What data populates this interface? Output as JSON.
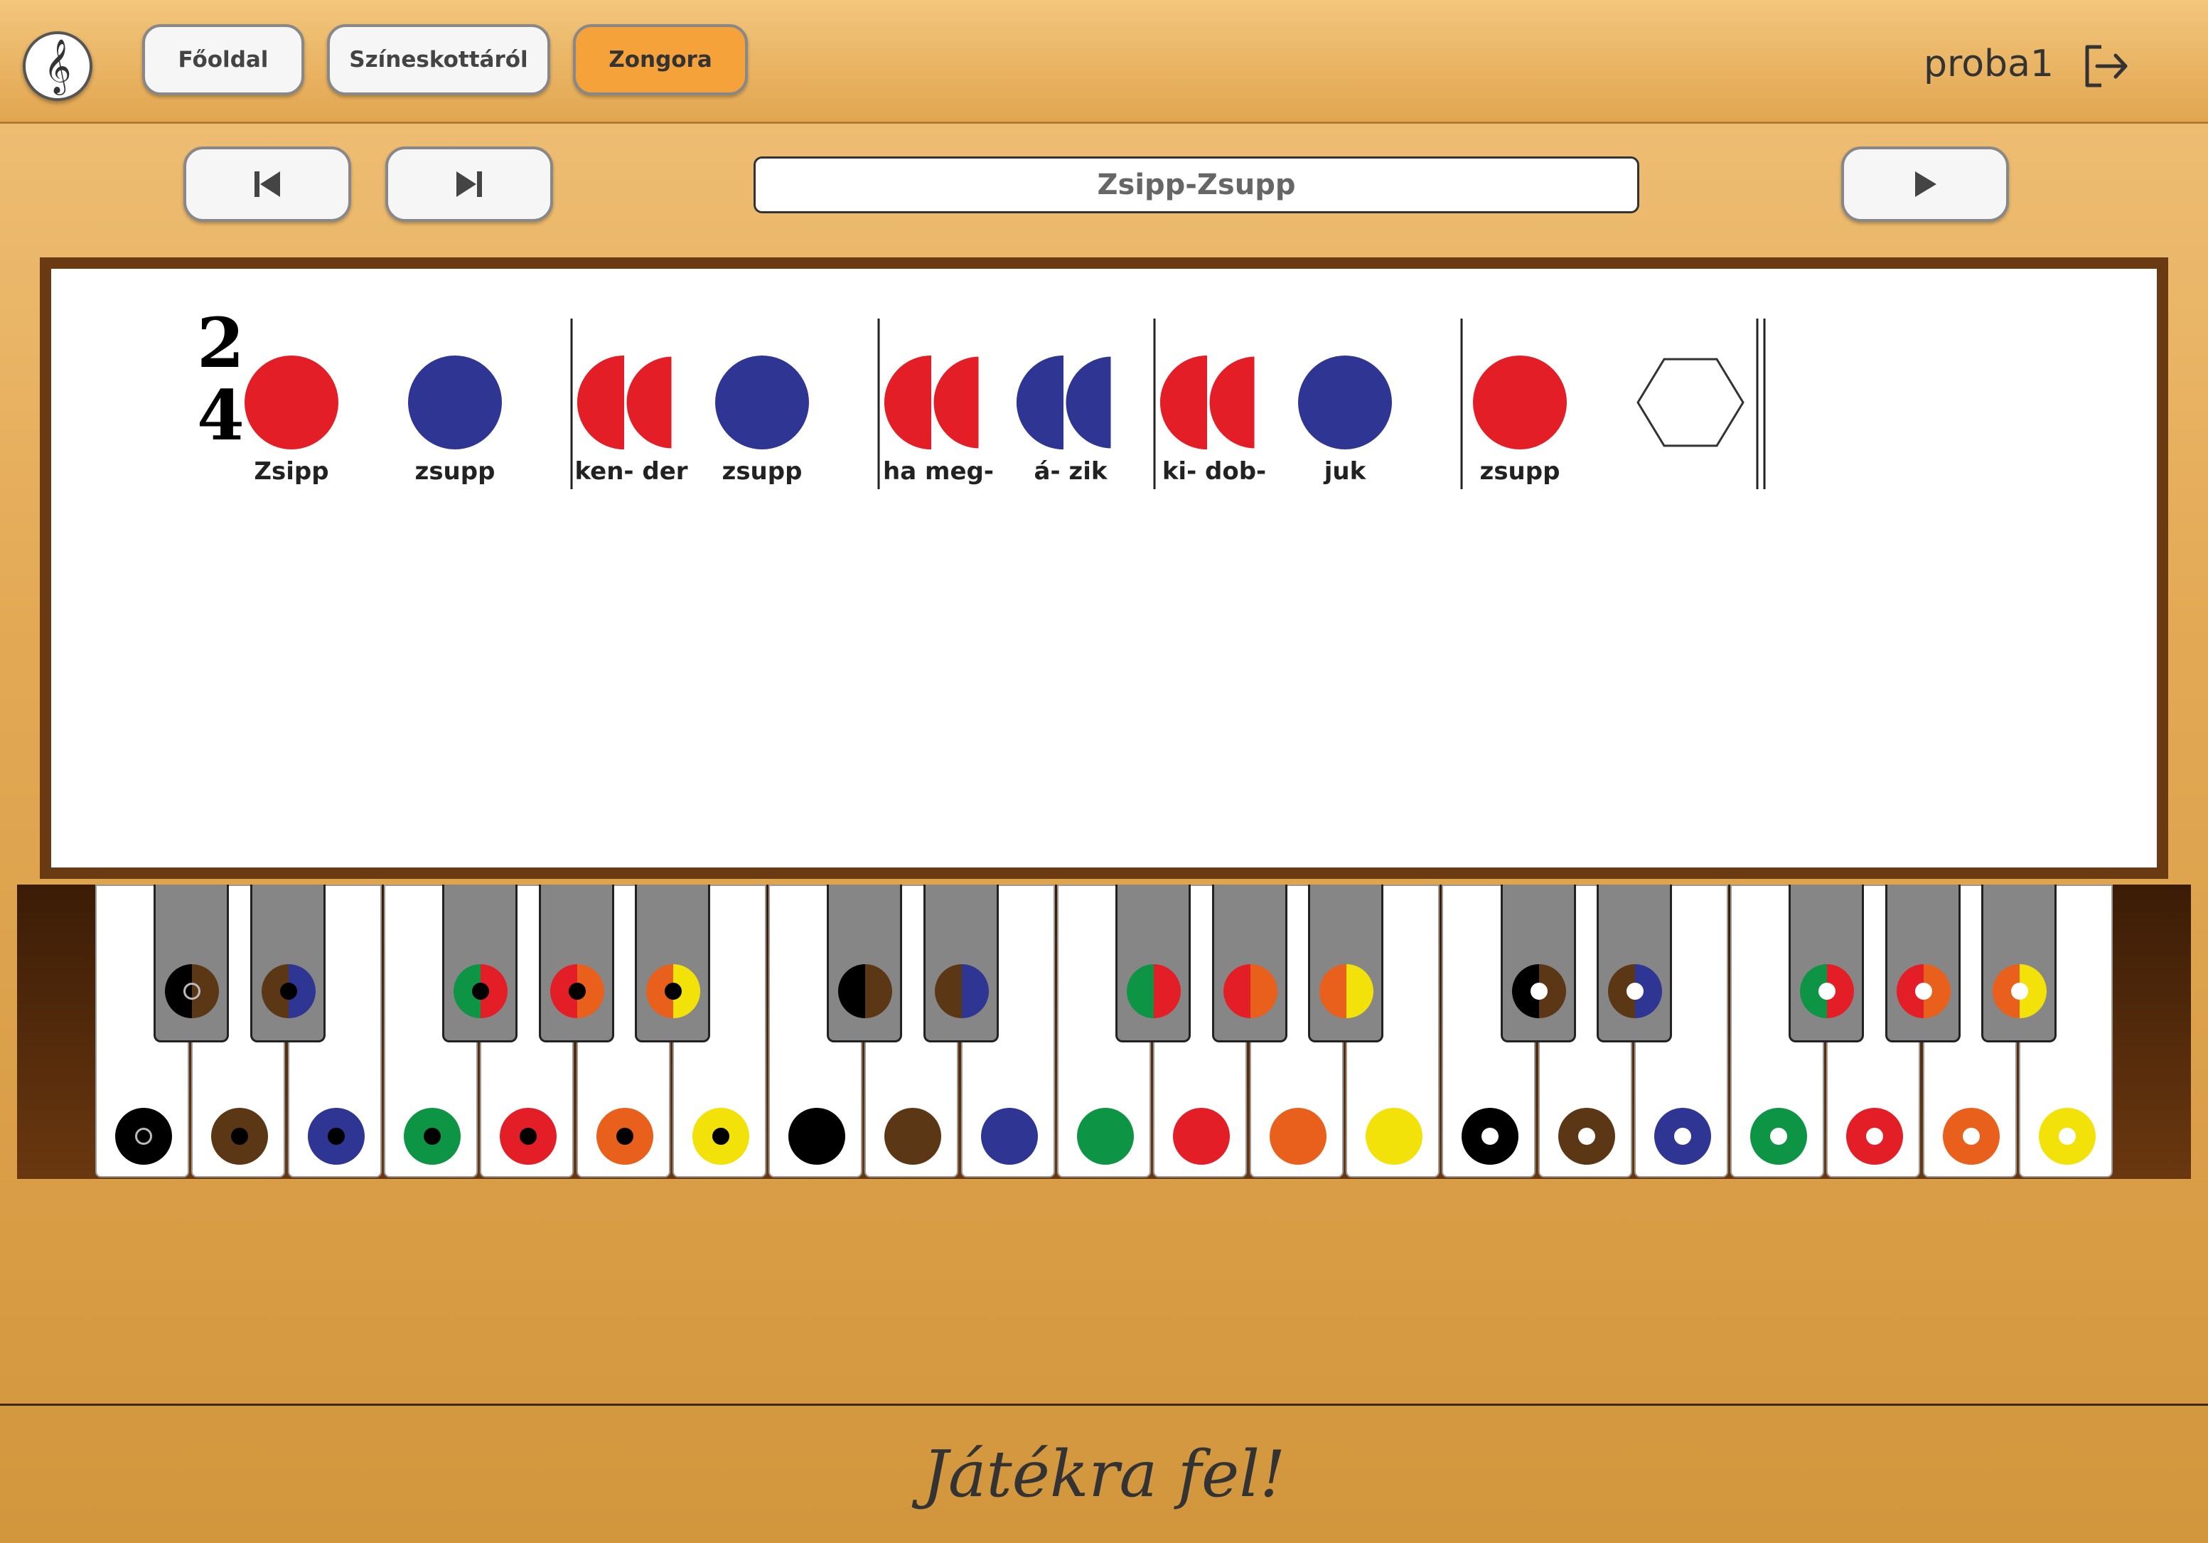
{
  "header": {
    "logo_glyph": "𝄞",
    "nav": [
      {
        "label": "Főoldal",
        "active": false
      },
      {
        "label": "Színeskottáról",
        "active": false
      },
      {
        "label": "Zongora",
        "active": true
      }
    ],
    "username": "proba1",
    "logout_icon": "logout-icon"
  },
  "controls": {
    "prev_icon": "skip-back-icon",
    "next_icon": "skip-forward-icon",
    "play_icon": "play-icon",
    "song_title": "Zsipp-Zsupp"
  },
  "score": {
    "time_signature": {
      "top": "2",
      "bottom": "4"
    },
    "notes": [
      {
        "type": "full",
        "colors": [
          "#e41e26"
        ],
        "lyric": "Zsipp"
      },
      {
        "type": "full",
        "colors": [
          "#2e3592"
        ],
        "lyric": "zsupp"
      },
      {
        "type": "bar"
      },
      {
        "type": "pair",
        "colors": [
          "#e41e26",
          "#e41e26"
        ],
        "lyric": "ken- der"
      },
      {
        "type": "full",
        "colors": [
          "#2e3592"
        ],
        "lyric": "zsupp"
      },
      {
        "type": "bar"
      },
      {
        "type": "pair",
        "colors": [
          "#e41e26",
          "#e41e26"
        ],
        "lyric": "ha  meg-"
      },
      {
        "type": "pair",
        "colors": [
          "#2e3592",
          "#2e3592"
        ],
        "lyric": "á-  zik"
      },
      {
        "type": "bar"
      },
      {
        "type": "pair",
        "colors": [
          "#e41e26",
          "#e41e26"
        ],
        "lyric": "ki-   dob-"
      },
      {
        "type": "full",
        "colors": [
          "#2e3592"
        ],
        "lyric": "juk"
      },
      {
        "type": "bar"
      },
      {
        "type": "full",
        "colors": [
          "#e41e26"
        ],
        "lyric": "zsupp"
      },
      {
        "type": "rest"
      },
      {
        "type": "end"
      }
    ]
  },
  "piano": {
    "white_keys": [
      {
        "color": "#000000",
        "inner": "ring"
      },
      {
        "color": "#5c3716",
        "inner": "#000000"
      },
      {
        "color": "#2e3592",
        "inner": "#000000"
      },
      {
        "color": "#0d9444",
        "inner": "#000000"
      },
      {
        "color": "#e41e26",
        "inner": "#000000"
      },
      {
        "color": "#e8601c",
        "inner": "#000000"
      },
      {
        "color": "#f2e20a",
        "inner": "#000000"
      },
      {
        "color": "#000000",
        "inner": null
      },
      {
        "color": "#5c3716",
        "inner": null
      },
      {
        "color": "#2e3592",
        "inner": null
      },
      {
        "color": "#0d9444",
        "inner": null
      },
      {
        "color": "#e41e26",
        "inner": null
      },
      {
        "color": "#e8601c",
        "inner": null
      },
      {
        "color": "#f2e20a",
        "inner": null
      },
      {
        "color": "#000000",
        "inner": "#ffffff"
      },
      {
        "color": "#5c3716",
        "inner": "#ffffff"
      },
      {
        "color": "#2e3592",
        "inner": "#ffffff"
      },
      {
        "color": "#0d9444",
        "inner": "#ffffff"
      },
      {
        "color": "#e41e26",
        "inner": "#ffffff"
      },
      {
        "color": "#e8601c",
        "inner": "#ffffff"
      },
      {
        "color": "#f2e20a",
        "inner": "#ffffff"
      }
    ],
    "black_keys": [
      {
        "after": 0,
        "left": "#000000",
        "right": "#5c3716",
        "inner": "ring"
      },
      {
        "after": 1,
        "left": "#5c3716",
        "right": "#2e3592",
        "inner": "#000000"
      },
      {
        "after": 3,
        "left": "#0d9444",
        "right": "#e41e26",
        "inner": "#000000"
      },
      {
        "after": 4,
        "left": "#e41e26",
        "right": "#e8601c",
        "inner": "#000000"
      },
      {
        "after": 5,
        "left": "#e8601c",
        "right": "#f2e20a",
        "inner": "#000000"
      },
      {
        "after": 7,
        "left": "#000000",
        "right": "#5c3716",
        "inner": null
      },
      {
        "after": 8,
        "left": "#5c3716",
        "right": "#2e3592",
        "inner": null
      },
      {
        "after": 10,
        "left": "#0d9444",
        "right": "#e41e26",
        "inner": null
      },
      {
        "after": 11,
        "left": "#e41e26",
        "right": "#e8601c",
        "inner": null
      },
      {
        "after": 12,
        "left": "#e8601c",
        "right": "#f2e20a",
        "inner": null
      },
      {
        "after": 14,
        "left": "#000000",
        "right": "#5c3716",
        "inner": "#ffffff"
      },
      {
        "after": 15,
        "left": "#5c3716",
        "right": "#2e3592",
        "inner": "#ffffff"
      },
      {
        "after": 17,
        "left": "#0d9444",
        "right": "#e41e26",
        "inner": "#ffffff"
      },
      {
        "after": 18,
        "left": "#e41e26",
        "right": "#e8601c",
        "inner": "#ffffff"
      },
      {
        "after": 19,
        "left": "#e8601c",
        "right": "#f2e20a",
        "inner": "#ffffff"
      }
    ]
  },
  "footer": {
    "text": "Játékra fel!"
  }
}
